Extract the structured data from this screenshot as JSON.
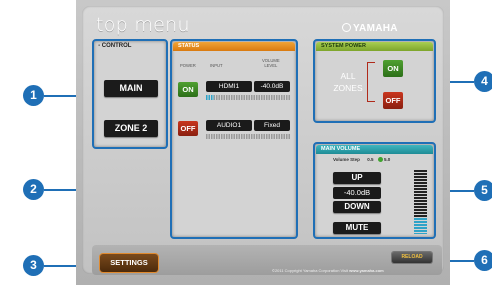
{
  "app": {
    "title": "top menu",
    "brand": "YAMAHA"
  },
  "control": {
    "header": "CONTROL",
    "main_label": "MAIN",
    "zone2_label": "ZONE 2"
  },
  "status": {
    "header": "STATUS",
    "columns": {
      "power": "POWER",
      "input": "INPUT",
      "volume_line1": "VOLUME",
      "volume_line2": "LEVEL"
    },
    "rows": [
      {
        "power": "ON",
        "input": "HDMI1",
        "volume": "-40.0dB",
        "level": 0.1
      },
      {
        "power": "OFF",
        "input": "AUDIO1",
        "volume": "Fixed",
        "level": 0.0
      }
    ]
  },
  "system_power": {
    "header": "SYSTEM POWER",
    "zones_line1": "ALL",
    "zones_line2": "ZONES",
    "on_label": "ON",
    "off_label": "OFF"
  },
  "main_volume": {
    "header": "MAIN VOLUME",
    "step_label": "Volume Step",
    "step_option_a": "0.5",
    "step_option_b": "5.0",
    "up_label": "UP",
    "level": "-40.0dB",
    "down_label": "DOWN",
    "mute_label": "MUTE",
    "meter_level": 0.25
  },
  "footer": {
    "settings_label": "SETTINGS",
    "reload_label": "RELOAD",
    "copyright": "©2011 Copyright Yamaha Corporation Visit",
    "site": "www.yamaha.com"
  },
  "callouts": [
    "1",
    "2",
    "3",
    "4",
    "5",
    "6"
  ],
  "colors": {
    "accent": "#1f6fb6",
    "on_green": "#3c8a25",
    "off_red": "#b32c17",
    "status_orange": "#e38a1a",
    "power_green": "#8ab63a",
    "volume_teal": "#2a9ea8"
  }
}
